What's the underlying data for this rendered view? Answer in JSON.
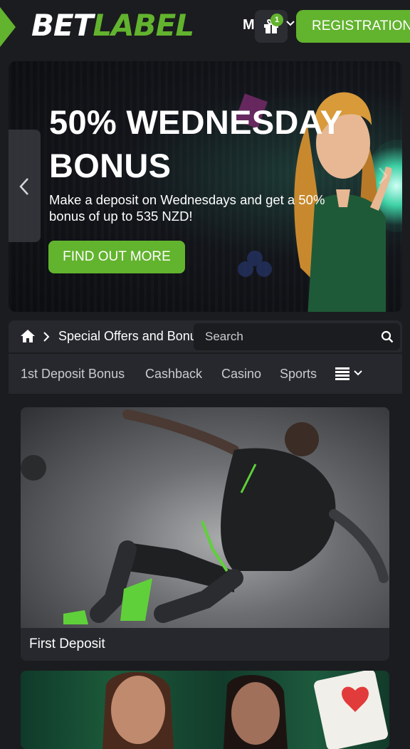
{
  "header": {
    "logo_bet": "BET",
    "logo_label": "LABEL",
    "lang": "M",
    "gift_count": "1",
    "register_label": "REGISTRATION"
  },
  "banner": {
    "title": "50% WEDNESDAY BONUS",
    "description": "Make a deposit on Wednesdays and get a 50% bonus of up to 535 NZD!",
    "cta_label": "FIND OUT MORE"
  },
  "breadcrumb": {
    "current": "Special Offers and Bonuses"
  },
  "search": {
    "placeholder": "Search"
  },
  "tabs": [
    {
      "label": "1st Deposit Bonus"
    },
    {
      "label": "Cashback"
    },
    {
      "label": "Casino"
    },
    {
      "label": "Sports"
    }
  ],
  "cards": [
    {
      "caption": "First Deposit"
    },
    {
      "caption": ""
    }
  ],
  "colors": {
    "brand_green": "#62b32e",
    "background": "#1b1c1f",
    "panel": "#26282d"
  }
}
